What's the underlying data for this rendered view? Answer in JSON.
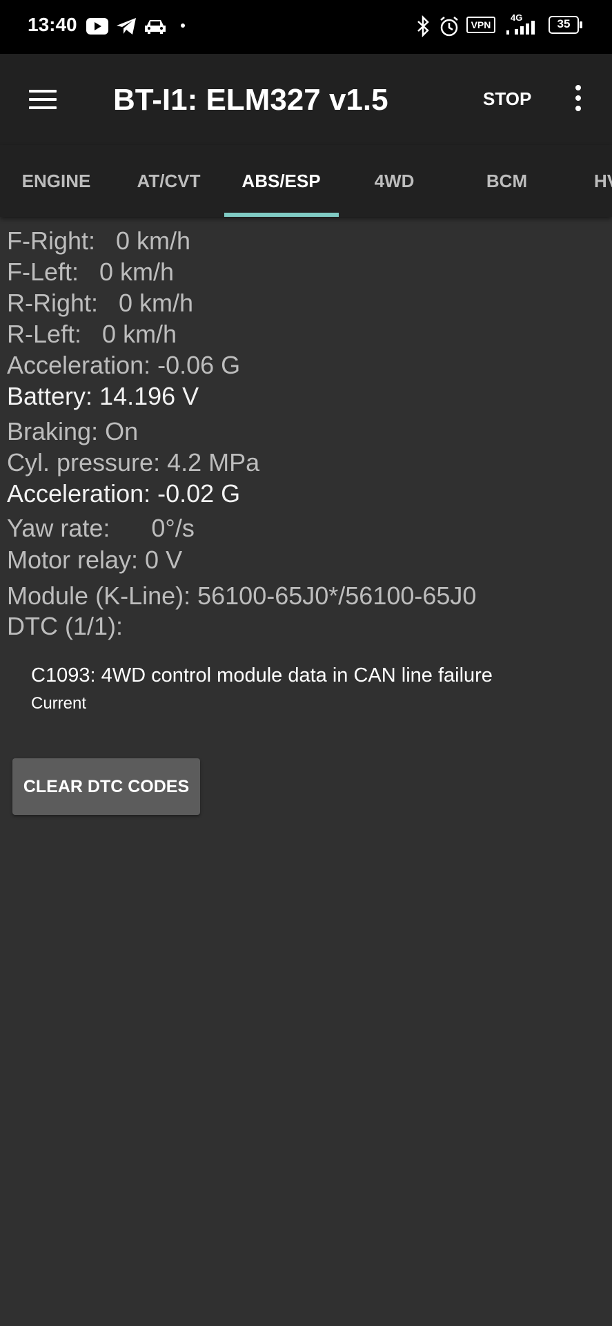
{
  "status_bar": {
    "time": "13:40",
    "left_icons": [
      "youtube-icon",
      "telegram-icon",
      "car-icon",
      "dot-icon"
    ],
    "right_icons": [
      "bluetooth-icon",
      "alarm-icon",
      "vpn-icon",
      "signal-4g-icon",
      "battery-icon"
    ],
    "vpn_label": "VPN",
    "network_label": "4G",
    "battery_level": "35"
  },
  "appbar": {
    "title": "BT-I1: ELM327 v1.5",
    "stop_label": "STOP",
    "menu_icon": "hamburger-menu-icon",
    "overflow_icon": "more-vert-icon"
  },
  "tabs": {
    "items": [
      {
        "label": "ENGINE"
      },
      {
        "label": "AT/CVT"
      },
      {
        "label": "ABS/ESP"
      },
      {
        "label": "4WD"
      },
      {
        "label": "BCM"
      },
      {
        "label": "HV"
      }
    ],
    "active_index": 2,
    "indicator_color": "#80cbc4"
  },
  "readings": {
    "f_right": "F-Right:   0 km/h",
    "f_left": "F-Left:   0 km/h",
    "r_right": "R-Right:   0 km/h",
    "r_left": "R-Left:   0 km/h",
    "acceleration_1": "Acceleration: -0.06 G",
    "battery": "Battery: 14.196 V",
    "braking": "Braking: On",
    "cyl_pressure": "Cyl. pressure: 4.2 MPa",
    "acceleration_2": "Acceleration: -0.02 G",
    "yaw_rate": "Yaw rate:      0°/s",
    "motor_relay": "Motor relay: 0 V",
    "module": "Module (K-Line): 56100-65J0*/56100-65J0",
    "dtc_header": "DTC (1/1):"
  },
  "dtc": {
    "code": "C1093: 4WD control module data in CAN line failure",
    "status": "Current"
  },
  "clear_button": {
    "label": "CLEAR DTC CODES"
  },
  "colors": {
    "background": "#303030",
    "appbar": "#212121",
    "text_dim": "#bdbdbd",
    "text_bright": "#f2f2f2",
    "button": "#5c5c5c"
  }
}
